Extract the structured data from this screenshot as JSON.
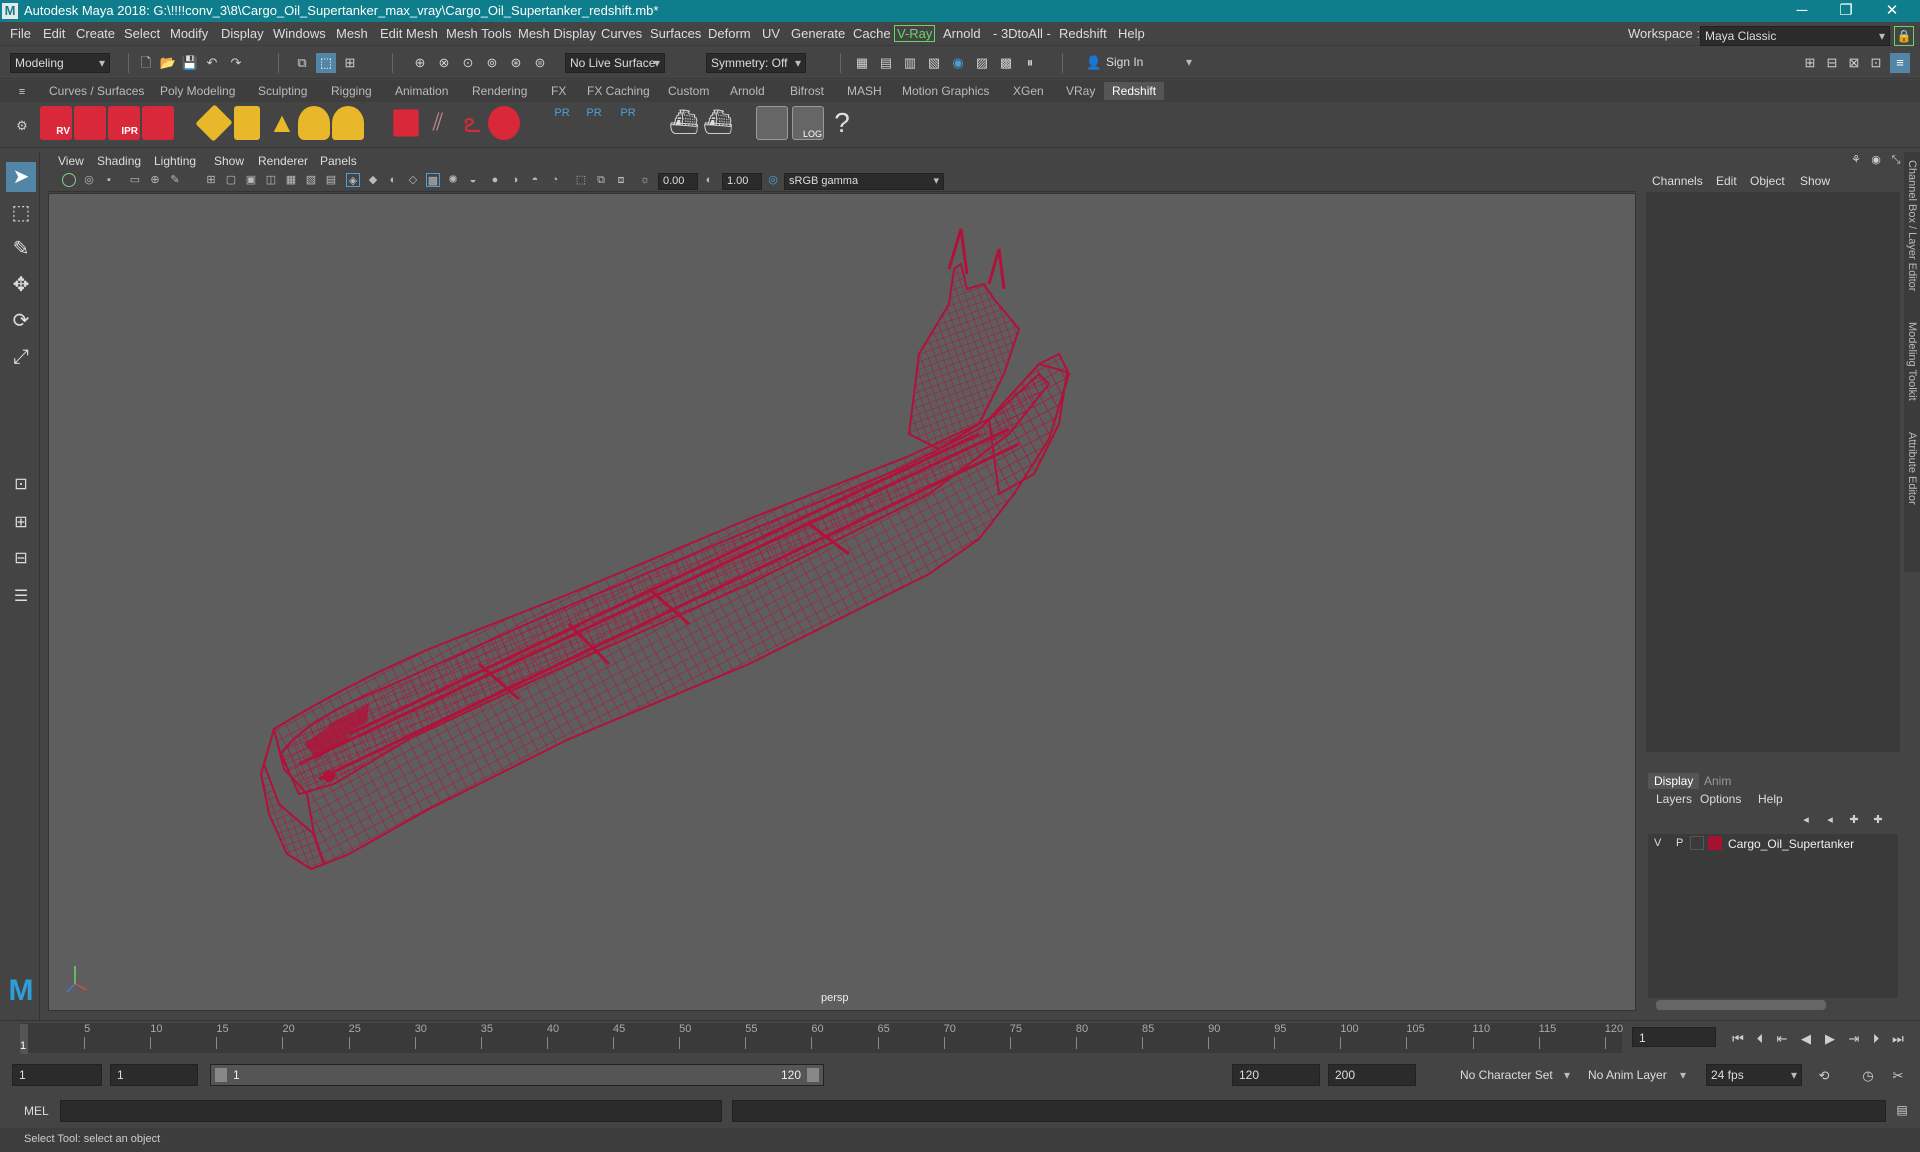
{
  "window": {
    "title": "Autodesk Maya 2018: G:\\!!!!conv_3\\8\\Cargo_Oil_Supertanker_max_vray\\Cargo_Oil_Supertanker_redshift.mb*",
    "logo": "M",
    "minimize": "─",
    "restore": "❐",
    "close": "✕"
  },
  "menus": [
    "File",
    "Edit",
    "Create",
    "Select",
    "Modify",
    "Display",
    "Windows",
    "Mesh",
    "Edit Mesh",
    "Mesh Tools",
    "Mesh Display",
    "Curves",
    "Surfaces",
    "Deform",
    "UV",
    "Generate",
    "Cache",
    "V-Ray",
    "Arnold",
    "- 3DtoAll -",
    "Redshift",
    "Help"
  ],
  "workspace": {
    "label": "Workspace :",
    "value": "Maya Classic"
  },
  "status_line": {
    "mode": "Modeling",
    "live_surface": "No Live Surface",
    "symmetry": "Symmetry: Off",
    "sign_in": "Sign In"
  },
  "shelf_tabs": [
    "Curves / Surfaces",
    "Poly Modeling",
    "Sculpting",
    "Rigging",
    "Animation",
    "Rendering",
    "FX",
    "FX Caching",
    "Custom",
    "Arnold",
    "Bifrost",
    "MASH",
    "Motion Graphics",
    "XGen",
    "VRay",
    "Redshift"
  ],
  "shelf_active": "Redshift",
  "shelf_labels": {
    "rv": "RV",
    "ipr": "IPR",
    "pr": "PR",
    "log": "LOG",
    "help": "?"
  },
  "viewport_menu": [
    "View",
    "Shading",
    "Lighting",
    "Show",
    "Renderer",
    "Panels"
  ],
  "viewport_toolbar": {
    "exposure": "0.00",
    "gamma": "1.00",
    "color_space": "sRGB gamma"
  },
  "viewport": {
    "camera": "persp",
    "model_color": "#b0123a",
    "background": "#5e5e5e"
  },
  "channel_box": {
    "menus": [
      "Channels",
      "Edit",
      "Object",
      "Show"
    ]
  },
  "layer_editor": {
    "tabs": [
      "Display",
      "Anim"
    ],
    "active_tab": "Display",
    "menus": [
      "Layers",
      "Options",
      "Help"
    ],
    "layers": [
      {
        "v": "V",
        "p": "P",
        "name": "Cargo_Oil_Supertanker",
        "color": "#a3122e"
      }
    ]
  },
  "side_tabs": [
    "Channel Box / Layer Editor",
    "Modeling Toolkit",
    "Attribute Editor"
  ],
  "timeline": {
    "ticks": [
      "5",
      "10",
      "15",
      "20",
      "25",
      "30",
      "35",
      "40",
      "45",
      "50",
      "55",
      "60",
      "65",
      "70",
      "75",
      "80",
      "85",
      "90",
      "95",
      "100",
      "105",
      "110",
      "115",
      "120"
    ],
    "start_label": "1",
    "current_frame": "1"
  },
  "range": {
    "anim_start": "1",
    "playback_start": "1",
    "slider_start": "1",
    "slider_end": "120",
    "playback_end": "120",
    "anim_end": "200",
    "character_set": "No Character Set",
    "anim_layer": "No Anim Layer",
    "fps": "24 fps"
  },
  "command_line": {
    "label": "MEL"
  },
  "help_line": "Select Tool: select an object"
}
